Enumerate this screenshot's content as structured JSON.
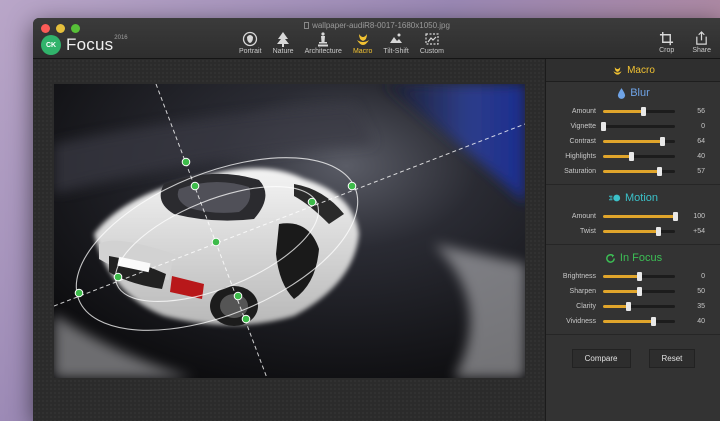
{
  "window": {
    "filename": "wallpaper-audiR8-0017-1680x1050.jpg"
  },
  "app": {
    "name": "Focus",
    "year": "2016",
    "badge": "CK"
  },
  "toolbar": {
    "modes": [
      {
        "label": "Portrait",
        "icon": "portrait-icon",
        "active": false
      },
      {
        "label": "Nature",
        "icon": "tree-icon",
        "active": false
      },
      {
        "label": "Architecture",
        "icon": "statue-icon",
        "active": false
      },
      {
        "label": "Macro",
        "icon": "flower-icon",
        "active": true
      },
      {
        "label": "Tilt-Shift",
        "icon": "tilt-shift-icon",
        "active": false
      },
      {
        "label": "Custom",
        "icon": "custom-icon",
        "active": false
      }
    ],
    "crop_label": "Crop",
    "share_label": "Share"
  },
  "panel": {
    "header": "Macro",
    "blur": {
      "title": "Blur",
      "rows": [
        {
          "label": "Amount",
          "value": "56",
          "level": 0.56
        },
        {
          "label": "Vignette",
          "value": "0",
          "level": 0.0
        },
        {
          "label": "Contrast",
          "value": "64",
          "level": 0.82
        },
        {
          "label": "Highlights",
          "value": "40",
          "level": 0.4
        },
        {
          "label": "Saturation",
          "value": "57",
          "level": 0.78
        }
      ]
    },
    "motion": {
      "title": "Motion",
      "rows": [
        {
          "label": "Amount",
          "value": "100",
          "level": 1.0
        },
        {
          "label": "Twist",
          "value": "+54",
          "level": 0.77
        }
      ]
    },
    "in_focus": {
      "title": "In Focus",
      "rows": [
        {
          "label": "Brightness",
          "value": "0",
          "level": 0.5
        },
        {
          "label": "Sharpen",
          "value": "50",
          "level": 0.5
        },
        {
          "label": "Clarity",
          "value": "35",
          "level": 0.35
        },
        {
          "label": "Vividness",
          "value": "40",
          "level": 0.7
        }
      ]
    },
    "compare_label": "Compare",
    "reset_label": "Reset"
  },
  "colors": {
    "accent": "#f1c232",
    "slider_fill": "#e0a52b",
    "blur_title": "#6fa3e6",
    "motion_title": "#3bc1c9",
    "focus_title": "#3cbf55",
    "handle": "#3dbb4a"
  }
}
